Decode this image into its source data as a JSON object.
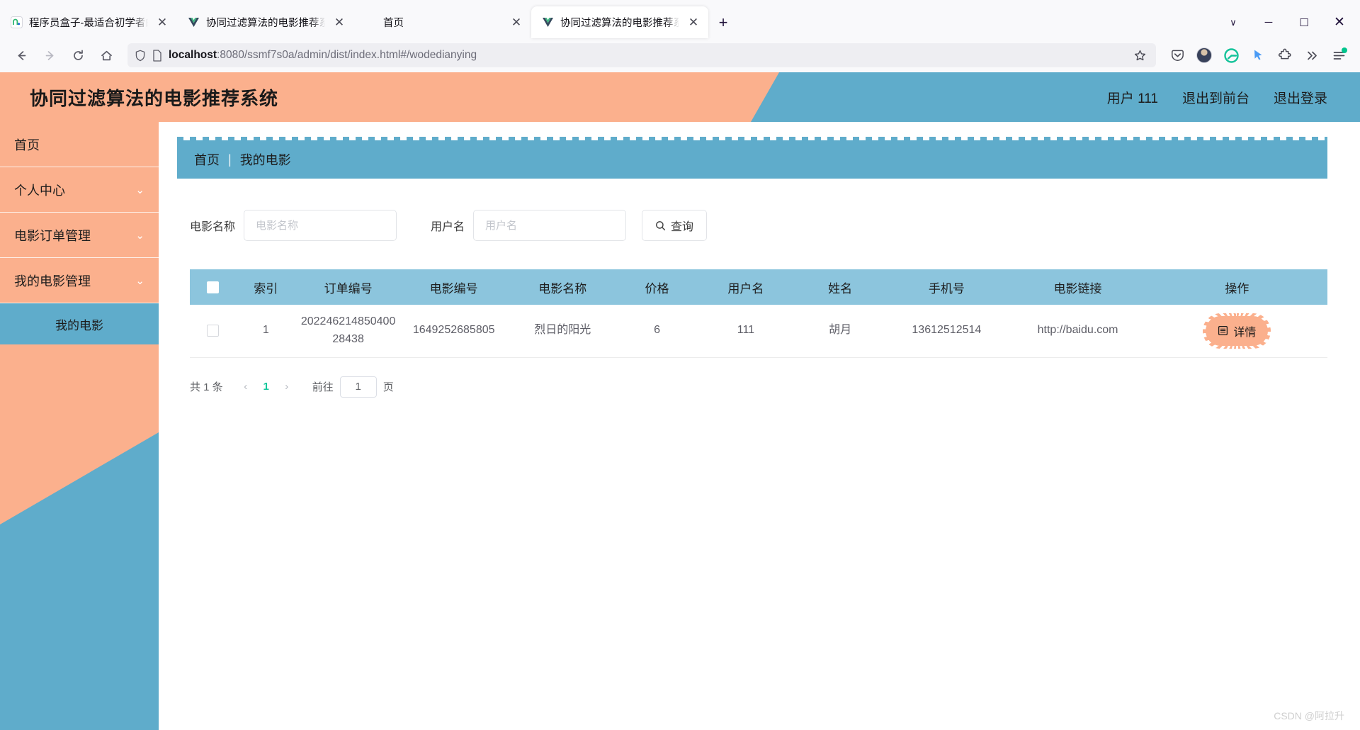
{
  "browser": {
    "tabs": [
      {
        "title": "程序员盒子-最适合初学者的免费...",
        "favicon": "n-logo-icon",
        "active": false
      },
      {
        "title": "协同过滤算法的电影推荐系统",
        "favicon": "vue-logo-icon",
        "active": false
      },
      {
        "title": "首页",
        "favicon": "none",
        "active": false
      },
      {
        "title": "协同过滤算法的电影推荐系统",
        "favicon": "vue-logo-icon",
        "active": true
      }
    ],
    "new_tab_label": "+",
    "close_label": "✕",
    "window_controls": {
      "list_all_tabs": "∨",
      "minimize": "─",
      "maximize": "☐",
      "close": "✕"
    },
    "nav": {
      "back": "←",
      "forward": "→",
      "reload": "↻",
      "home": "⌂"
    },
    "url": {
      "host": "localhost",
      "path": ":8080/ssmf7s0a/admin/dist/index.html#/wodedianying",
      "full": "localhost:8080/ssmf7s0a/admin/dist/index.html#/wodedianying",
      "shield_icon": "shield-icon",
      "page_icon": "page-icon",
      "bookmark_icon": "star-icon"
    },
    "toolbar_icons": [
      "pocket-icon",
      "account-avatar",
      "grammarly-icon",
      "cursor-icon",
      "extensions-icon",
      "overflow-chevrons-icon",
      "app-menu-icon"
    ]
  },
  "app": {
    "title": "协同过滤算法的电影推荐系统",
    "header_links": [
      "用户 111",
      "退出到前台",
      "退出登录"
    ],
    "colors": {
      "peach": "#fbb08d",
      "blue": "#5faccb",
      "table_header": "#8cc5dd",
      "pager_active": "#12c79b"
    }
  },
  "sidebar": {
    "items": [
      {
        "label": "首页",
        "has_caret": false
      },
      {
        "label": "个人中心",
        "has_caret": true
      },
      {
        "label": "电影订单管理",
        "has_caret": true
      },
      {
        "label": "我的电影管理",
        "has_caret": true
      }
    ],
    "active_sub_item": "我的电影",
    "caret_glyph": "⌄"
  },
  "breadcrumb": {
    "root": "首页",
    "separator": "|",
    "current": "我的电影"
  },
  "search": {
    "movie_label": "电影名称",
    "movie_placeholder": "电影名称",
    "movie_value": "",
    "user_label": "用户名",
    "user_placeholder": "用户名",
    "user_value": "",
    "button_label": "查询",
    "button_icon": "search-icon"
  },
  "table": {
    "columns": [
      "",
      "索引",
      "订单编号",
      "电影编号",
      "电影名称",
      "价格",
      "用户名",
      "姓名",
      "手机号",
      "电影链接",
      "操作"
    ],
    "rows": [
      {
        "index": "1",
        "order_no": "20224621485040028438",
        "movie_no": "1649252685805",
        "movie_name": "烈日的阳光",
        "price": "6",
        "username": "111",
        "name": "胡月",
        "phone": "13612512514",
        "link": "http://baidu.com",
        "action_label": "详情",
        "action_icon": "document-icon"
      }
    ]
  },
  "pagination": {
    "total_text": "共 1 条",
    "prev_glyph": "‹",
    "next_glyph": "›",
    "current_page": "1",
    "goto_label": "前往",
    "goto_value": "1",
    "page_unit": "页"
  },
  "watermark": "CSDN @阿拉升"
}
